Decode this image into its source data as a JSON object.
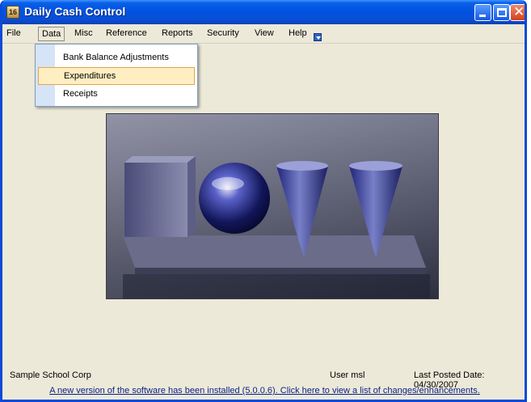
{
  "window": {
    "title": "Daily Cash Control",
    "icon": "app-icon",
    "icon_glyph": "16"
  },
  "menu": {
    "items": [
      {
        "id": "file",
        "label": "File"
      },
      {
        "id": "data",
        "label": "Data"
      },
      {
        "id": "misc",
        "label": "Misc"
      },
      {
        "id": "reference",
        "label": "Reference"
      },
      {
        "id": "reports",
        "label": "Reports"
      },
      {
        "id": "security",
        "label": "Security"
      },
      {
        "id": "view",
        "label": "View"
      },
      {
        "id": "help",
        "label": "Help"
      }
    ],
    "active": "Data"
  },
  "dropdown": {
    "items": [
      {
        "label": "Bank Balance Adjustments"
      },
      {
        "label": "Expenditures",
        "highlighted": true
      },
      {
        "label": "Receipts"
      }
    ]
  },
  "status": {
    "organization": "Sample School Corp",
    "user": "User msl",
    "last_posted": "Last Posted Date: 04/30/2007"
  },
  "notice": "A new version of the software has been installed (5.0.0.6).  Click here to view a list of changes/enhancements."
}
